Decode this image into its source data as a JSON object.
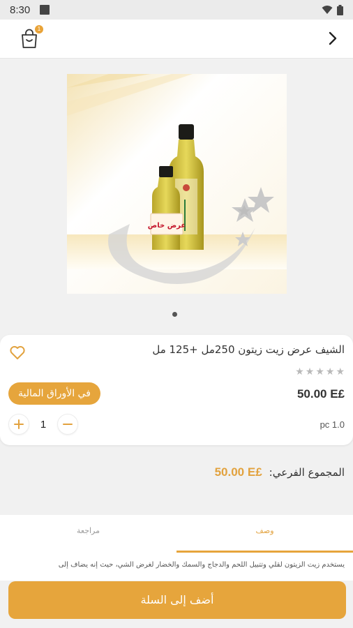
{
  "status_bar": {
    "time": "8:30"
  },
  "header": {
    "cart_count": "1"
  },
  "product": {
    "image_label": "عرض خاص",
    "title": "الشيف عرض زيت زيتون 250مل +125 مل",
    "rating_max": 5,
    "rating": 0,
    "stock_label": "في الأوراق المالية",
    "price": "50.00 E£",
    "quantity": "1",
    "unit": "pc 1.0"
  },
  "subtotal": {
    "label": "المجموع الفرعي:",
    "amount": "50.00 E£"
  },
  "tabs": [
    {
      "label": "وصف",
      "active": true
    },
    {
      "label": "مراجعة",
      "active": false
    }
  ],
  "description": "يستخدم زيت الزيتون لقلي وتتبيل اللحم والدجاج والسمك والخضار لغرض الشي، حيث إنه يضاف إلى",
  "add_to_cart_label": "أضف إلى السلة",
  "colors": {
    "accent": "#e6a53c",
    "price_accent": "#e2a23e"
  },
  "icons": {
    "back": "chevron-right-icon",
    "cart": "shopping-bag-icon",
    "favorite": "heart-outline-icon",
    "plus": "plus-icon",
    "minus": "minus-icon",
    "star": "star-icon"
  }
}
